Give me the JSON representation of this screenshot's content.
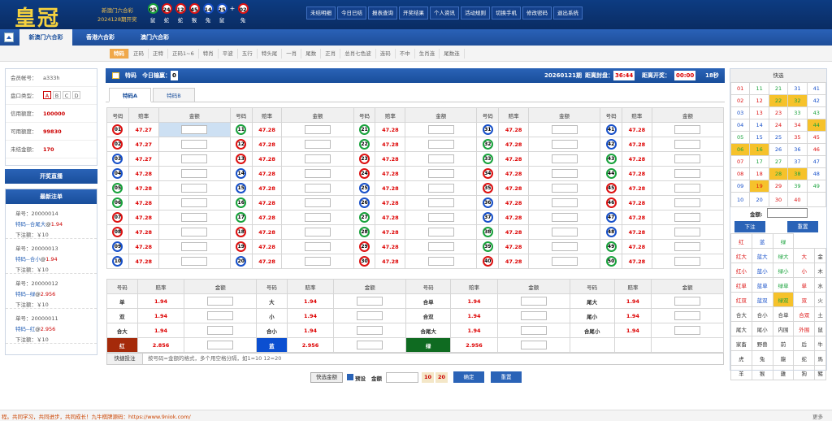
{
  "header": {
    "logo": "皇冠",
    "line1": "新澳门六合彩",
    "line2": "2024128期开奖",
    "balls": [
      {
        "num": "05",
        "zodiac": "鼠",
        "color": "#18a23b"
      },
      {
        "num": "24",
        "zodiac": "蛇",
        "color": "#d11"
      },
      {
        "num": "12",
        "zodiac": "蛇",
        "color": "#d11"
      },
      {
        "num": "45",
        "zodiac": "猴",
        "color": "#d11"
      },
      {
        "num": "14",
        "zodiac": "兔",
        "color": "#1750c9"
      },
      {
        "num": "25",
        "zodiac": "鼠",
        "color": "#1750c9"
      },
      {
        "num": "02",
        "zodiac": "兔",
        "color": "#d11"
      }
    ],
    "plus": "+",
    "nav": [
      "未结明细",
      "今日已结",
      "报表查询",
      "开奖结果",
      "个人资讯",
      "活动规则",
      "切换手机",
      "修改密码",
      "退出系统"
    ]
  },
  "tabs": [
    "新澳门六合彩",
    "香港六合彩",
    "澳门六合彩"
  ],
  "subtabs": [
    "特码",
    "正码",
    "正特",
    "正码1~6",
    "特肖",
    "平波",
    "五行",
    "特头尾",
    "一肖",
    "尾数",
    "正肖",
    "总肖七色波",
    "连码",
    "不中",
    "生肖连",
    "尾数连"
  ],
  "account": {
    "rows": [
      {
        "label": "会员帐号：",
        "value": "a333h"
      },
      {
        "label": "盘口类型：",
        "value": ""
      },
      {
        "label": "信用额度：",
        "value": "100000"
      },
      {
        "label": "可用额度：",
        "value": "99830"
      },
      {
        "label": "未结金额：",
        "value": "170"
      }
    ],
    "pan": [
      "A",
      "B",
      "C",
      "D"
    ],
    "live": "开奖直播",
    "latest": "最新注单"
  },
  "bets": [
    {
      "no": "单号：20000014",
      "item": "特码--合尾大",
      "rate": "1.94",
      "amt": "下注额：￥10"
    },
    {
      "no": "单号：20000013",
      "item": "特码--合小",
      "rate": "1.94",
      "amt": "下注额：￥10"
    },
    {
      "no": "单号：20000012",
      "item": "特码--绿",
      "rate": "2.956",
      "amt": "下注额：￥10"
    },
    {
      "no": "单号：20000011",
      "item": "特码--红",
      "rate": "2.956",
      "amt": "下注额：￥10"
    }
  ],
  "at": "@",
  "main": {
    "title": "特码",
    "today_label": "今日输赢：",
    "today_val": "0",
    "period": "20260121期",
    "close_label": "距离封盘：",
    "close_time": "36:44",
    "open_label": "距离开奖：",
    "open_time": "00:00",
    "secs": "18秒",
    "subtabs": [
      "特码A",
      "特码B"
    ],
    "col_headers": [
      "号码",
      "赔率",
      "金额"
    ],
    "rate": "47.28",
    "rate_b": "47.27"
  },
  "bottom": {
    "rows": [
      [
        {
          "n": "单",
          "r": "1.94"
        },
        {
          "n": "大",
          "r": "1.94"
        },
        {
          "n": "合单",
          "r": "1.94"
        },
        {
          "n": "尾大",
          "r": "1.94"
        }
      ],
      [
        {
          "n": "双",
          "r": "1.94"
        },
        {
          "n": "小",
          "r": "1.94"
        },
        {
          "n": "合双",
          "r": "1.94"
        },
        {
          "n": "尾小",
          "r": "1.94"
        }
      ],
      [
        {
          "n": "合大",
          "r": "1.94"
        },
        {
          "n": "合小",
          "r": "1.94"
        },
        {
          "n": "合尾大",
          "r": "1.94"
        },
        {
          "n": "合尾小",
          "r": "1.94"
        }
      ],
      [
        {
          "n": "红",
          "r": "2.856"
        },
        {
          "n": "蓝",
          "r": "2.956"
        },
        {
          "n": "绿",
          "r": "2.956"
        },
        {
          "n": "",
          "r": ""
        }
      ]
    ]
  },
  "quick": {
    "label": "快捷投注",
    "hint": "按号码=金额的格式，多个用空格分隔，如1=10 12=20",
    "btn_amt": "快选金额",
    "preset": "预设",
    "amount": "金额",
    "v10": "10",
    "v20": "20",
    "confirm": "确定",
    "reset": "重置"
  },
  "right": {
    "title": "快选",
    "amount": "金额:",
    "bet": "下注",
    "reset": "重置",
    "groups": [
      [
        "红",
        "蓝",
        "绿"
      ],
      [
        "红大",
        "蓝大",
        "绿大",
        "大",
        "金"
      ],
      [
        "红小",
        "蓝小",
        "绿小",
        "小",
        "木"
      ],
      [
        "红单",
        "蓝单",
        "绿单",
        "单",
        "水"
      ],
      [
        "红双",
        "蓝双",
        "绿双",
        "双",
        "火"
      ],
      [
        "合大",
        "合小",
        "合单",
        "合双",
        "土"
      ],
      [
        "尾大",
        "尾小",
        "内围",
        "外围",
        "鼠"
      ],
      [
        "家畜",
        "野兽",
        "前",
        "后",
        "牛"
      ],
      [
        "虎",
        "兔",
        "龍",
        "蛇",
        "馬"
      ],
      [
        "羊",
        "猴",
        "雞",
        "狗",
        "豬"
      ]
    ]
  },
  "footer": {
    "text": "程。共同学习，共同进步，共同成长！九牛棋牌源码：https://www.9niok.com/",
    "more": "更多"
  }
}
